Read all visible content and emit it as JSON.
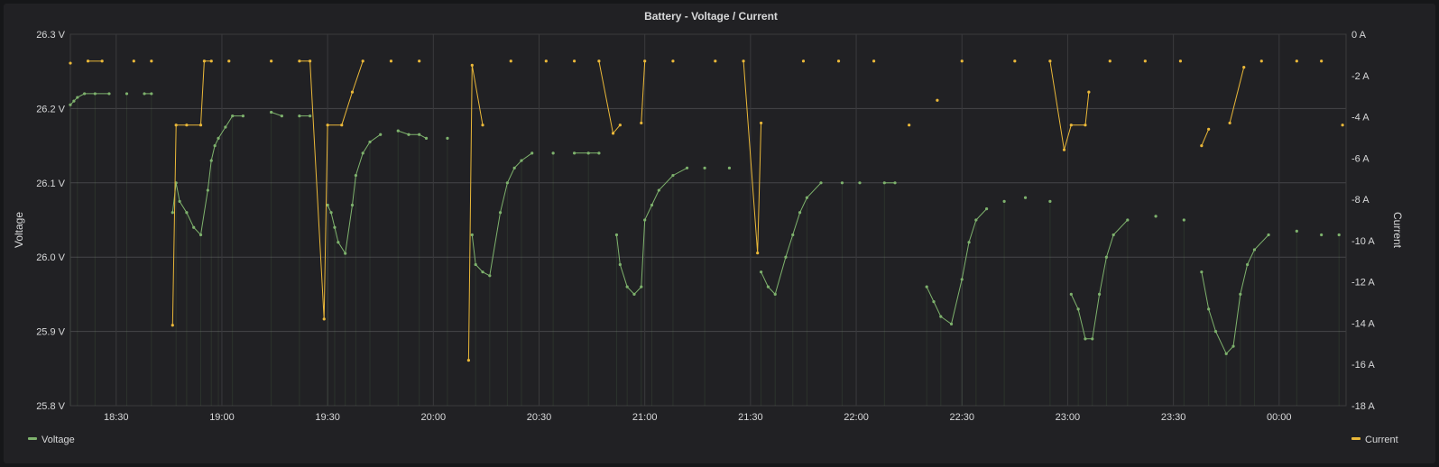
{
  "chart_data": {
    "type": "line",
    "title": "Battery - Voltage / Current",
    "x_ticks": [
      "18:30",
      "19:00",
      "19:30",
      "20:00",
      "20:30",
      "21:00",
      "21:30",
      "22:00",
      "22:30",
      "23:00",
      "23:30",
      "00:00"
    ],
    "x_range": [
      "18:17",
      "00:19"
    ],
    "left_axis": {
      "label": "Voltage",
      "range": [
        25.8,
        26.3
      ],
      "ticks": [
        "25.8 V",
        "25.9 V",
        "26.0 V",
        "26.1 V",
        "26.2 V",
        "26.3 V"
      ]
    },
    "right_axis": {
      "label": "Current",
      "range": [
        -18,
        0
      ],
      "ticks": [
        "-18 A",
        "-16 A",
        "-14 A",
        "-12 A",
        "-10 A",
        "-8 A",
        "-6 A",
        "-4 A",
        "-2 A",
        "0 A"
      ]
    },
    "grid": true,
    "legend_position": "bottom",
    "series": [
      {
        "name": "Voltage",
        "axis": "left",
        "color": "#7eb26d",
        "points": [
          [
            "18:17",
            26.205
          ],
          [
            "18:18",
            26.21
          ],
          [
            "18:19",
            26.215
          ],
          [
            "18:21",
            26.22
          ],
          [
            "18:24",
            26.22
          ],
          [
            "18:28",
            26.22
          ],
          [
            "18:33",
            26.22
          ],
          [
            "18:38",
            26.22
          ],
          [
            "18:40",
            26.22
          ],
          [
            "18:46",
            26.06
          ],
          [
            "18:47",
            26.1
          ],
          [
            "18:48",
            26.075
          ],
          [
            "18:50",
            26.06
          ],
          [
            "18:52",
            26.04
          ],
          [
            "18:54",
            26.03
          ],
          [
            "18:56",
            26.09
          ],
          [
            "18:57",
            26.13
          ],
          [
            "18:58",
            26.15
          ],
          [
            "18:59",
            26.16
          ],
          [
            "19:01",
            26.175
          ],
          [
            "19:03",
            26.19
          ],
          [
            "19:06",
            26.19
          ],
          [
            "19:14",
            26.195
          ],
          [
            "19:17",
            26.19
          ],
          [
            "19:22",
            26.19
          ],
          [
            "19:25",
            26.19
          ],
          [
            "19:30",
            26.07
          ],
          [
            "19:31",
            26.06
          ],
          [
            "19:32",
            26.04
          ],
          [
            "19:33",
            26.02
          ],
          [
            "19:35",
            26.005
          ],
          [
            "19:37",
            26.07
          ],
          [
            "19:38",
            26.11
          ],
          [
            "19:40",
            26.14
          ],
          [
            "19:42",
            26.155
          ],
          [
            "19:45",
            26.165
          ],
          [
            "19:50",
            26.17
          ],
          [
            "19:53",
            26.165
          ],
          [
            "19:56",
            26.165
          ],
          [
            "19:58",
            26.16
          ],
          [
            "20:04",
            26.16
          ],
          [
            "20:11",
            26.03
          ],
          [
            "20:12",
            25.99
          ],
          [
            "20:14",
            25.98
          ],
          [
            "20:16",
            25.975
          ],
          [
            "20:19",
            26.06
          ],
          [
            "20:21",
            26.1
          ],
          [
            "20:23",
            26.12
          ],
          [
            "20:25",
            26.13
          ],
          [
            "20:28",
            26.14
          ],
          [
            "20:34",
            26.14
          ],
          [
            "20:40",
            26.14
          ],
          [
            "20:44",
            26.14
          ],
          [
            "20:47",
            26.14
          ],
          [
            "20:52",
            26.03
          ],
          [
            "20:53",
            25.99
          ],
          [
            "20:55",
            25.96
          ],
          [
            "20:57",
            25.95
          ],
          [
            "20:59",
            25.96
          ],
          [
            "21:00",
            26.05
          ],
          [
            "21:02",
            26.07
          ],
          [
            "21:04",
            26.09
          ],
          [
            "21:08",
            26.11
          ],
          [
            "21:12",
            26.12
          ],
          [
            "21:17",
            26.12
          ],
          [
            "21:24",
            26.12
          ],
          [
            "21:33",
            25.98
          ],
          [
            "21:35",
            25.96
          ],
          [
            "21:37",
            25.95
          ],
          [
            "21:40",
            26.0
          ],
          [
            "21:42",
            26.03
          ],
          [
            "21:44",
            26.06
          ],
          [
            "21:46",
            26.08
          ],
          [
            "21:50",
            26.1
          ],
          [
            "21:56",
            26.1
          ],
          [
            "22:01",
            26.1
          ],
          [
            "22:08",
            26.1
          ],
          [
            "22:11",
            26.1
          ],
          [
            "22:20",
            25.96
          ],
          [
            "22:22",
            25.94
          ],
          [
            "22:24",
            25.92
          ],
          [
            "22:27",
            25.91
          ],
          [
            "22:30",
            25.97
          ],
          [
            "22:32",
            26.02
          ],
          [
            "22:34",
            26.05
          ],
          [
            "22:37",
            26.065
          ],
          [
            "22:42",
            26.075
          ],
          [
            "22:48",
            26.08
          ],
          [
            "22:55",
            26.075
          ],
          [
            "23:01",
            25.95
          ],
          [
            "23:03",
            25.93
          ],
          [
            "23:05",
            25.89
          ],
          [
            "23:07",
            25.89
          ],
          [
            "23:09",
            25.95
          ],
          [
            "23:11",
            26.0
          ],
          [
            "23:13",
            26.03
          ],
          [
            "23:17",
            26.05
          ],
          [
            "23:25",
            26.055
          ],
          [
            "23:33",
            26.05
          ],
          [
            "23:38",
            25.98
          ],
          [
            "23:40",
            25.93
          ],
          [
            "23:42",
            25.9
          ],
          [
            "23:45",
            25.87
          ],
          [
            "23:47",
            25.88
          ],
          [
            "23:49",
            25.95
          ],
          [
            "23:51",
            25.99
          ],
          [
            "23:53",
            26.01
          ],
          [
            "23:57",
            26.03
          ],
          [
            "00:05",
            26.035
          ],
          [
            "00:12",
            26.03
          ],
          [
            "00:17",
            26.03
          ]
        ]
      },
      {
        "name": "Current",
        "axis": "right",
        "color": "#eab839",
        "points": [
          [
            "18:17",
            -1.4
          ],
          [
            "18:22",
            -1.3
          ],
          [
            "18:26",
            -1.3
          ],
          [
            "18:35",
            -1.3
          ],
          [
            "18:40",
            -1.3
          ],
          [
            "18:46",
            -14.1
          ],
          [
            "18:47",
            -4.4
          ],
          [
            "18:50",
            -4.4
          ],
          [
            "18:54",
            -4.4
          ],
          [
            "18:55",
            -1.3
          ],
          [
            "18:57",
            -1.3
          ],
          [
            "19:02",
            -1.3
          ],
          [
            "19:14",
            -1.3
          ],
          [
            "19:22",
            -1.3
          ],
          [
            "19:25",
            -1.3
          ],
          [
            "19:29",
            -13.8
          ],
          [
            "19:30",
            -4.4
          ],
          [
            "19:34",
            -4.4
          ],
          [
            "19:37",
            -2.8
          ],
          [
            "19:40",
            -1.3
          ],
          [
            "19:48",
            -1.3
          ],
          [
            "19:56",
            -1.3
          ],
          [
            "20:10",
            -15.8
          ],
          [
            "20:11",
            -1.5
          ],
          [
            "20:14",
            -4.4
          ],
          [
            "20:22",
            -1.3
          ],
          [
            "20:32",
            -1.3
          ],
          [
            "20:40",
            -1.3
          ],
          [
            "20:47",
            -1.3
          ],
          [
            "20:51",
            -4.8
          ],
          [
            "20:53",
            -4.4
          ],
          [
            "20:59",
            -4.3
          ],
          [
            "21:00",
            -1.3
          ],
          [
            "21:08",
            -1.3
          ],
          [
            "21:20",
            -1.3
          ],
          [
            "21:28",
            -1.3
          ],
          [
            "21:32",
            -10.6
          ],
          [
            "21:33",
            -4.3
          ],
          [
            "21:45",
            -1.3
          ],
          [
            "21:55",
            -1.3
          ],
          [
            "22:05",
            -1.3
          ],
          [
            "22:15",
            -4.4
          ],
          [
            "22:23",
            -3.2
          ],
          [
            "22:30",
            -1.3
          ],
          [
            "22:45",
            -1.3
          ],
          [
            "22:55",
            -1.3
          ],
          [
            "22:59",
            -5.6
          ],
          [
            "23:01",
            -4.4
          ],
          [
            "23:05",
            -4.4
          ],
          [
            "23:06",
            -2.8
          ],
          [
            "23:12",
            -1.3
          ],
          [
            "23:22",
            -1.3
          ],
          [
            "23:32",
            -1.3
          ],
          [
            "23:38",
            -5.4
          ],
          [
            "23:40",
            -4.6
          ],
          [
            "23:46",
            -4.3
          ],
          [
            "23:50",
            -1.6
          ],
          [
            "23:55",
            -1.3
          ],
          [
            "00:05",
            -1.3
          ],
          [
            "00:12",
            -1.3
          ],
          [
            "00:18",
            -4.4
          ]
        ]
      }
    ]
  }
}
